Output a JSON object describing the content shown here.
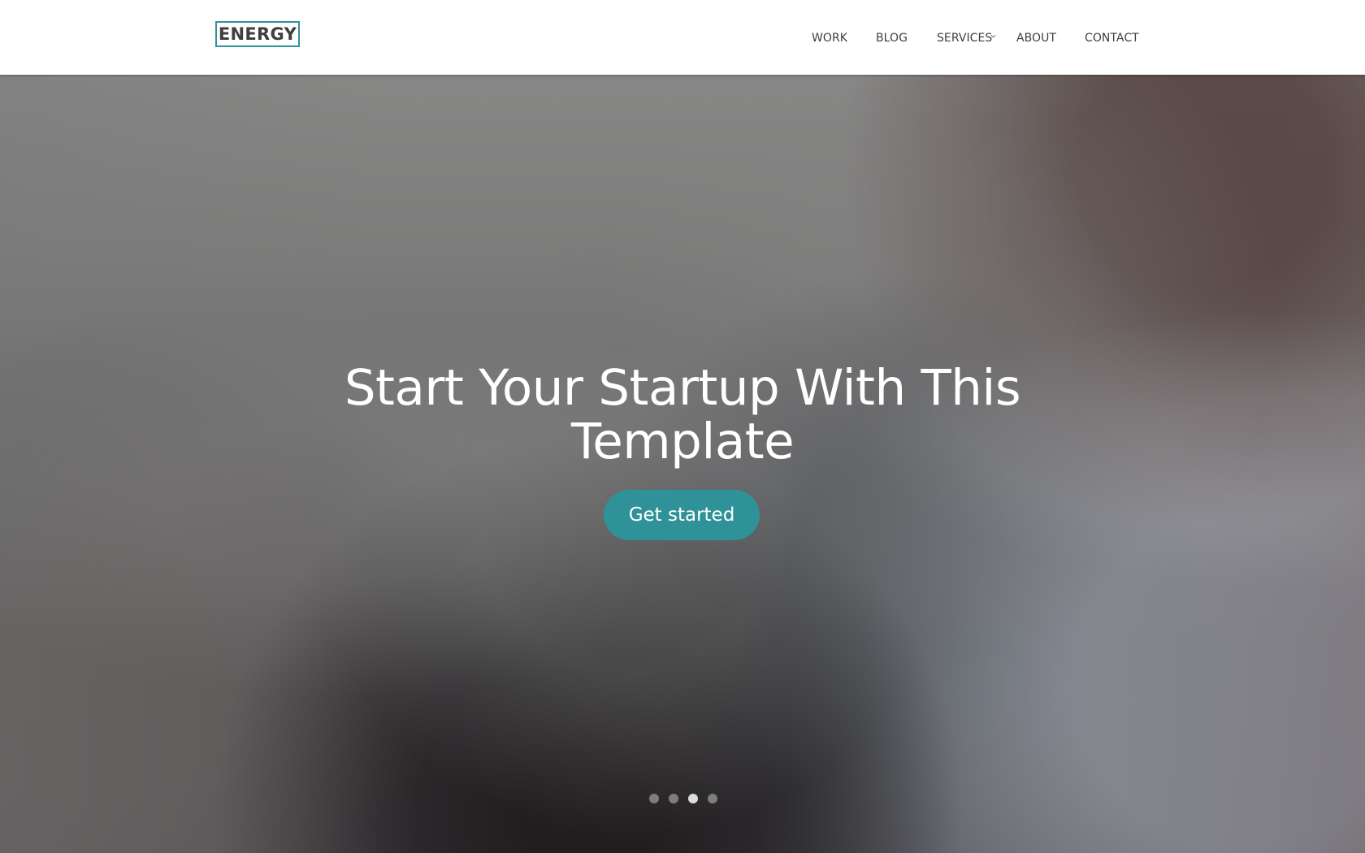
{
  "brand": {
    "name": "ENERGY",
    "accent_color": "#2f9298"
  },
  "nav": {
    "items": [
      {
        "label": "WORK"
      },
      {
        "label": "BLOG"
      },
      {
        "label": "SERVICES",
        "icon": "chevron-down-icon"
      },
      {
        "label": "ABOUT"
      },
      {
        "label": "CONTACT"
      }
    ]
  },
  "hero": {
    "title": "Start Your Startup With This Template",
    "cta_label": "Get started",
    "slider": {
      "total_slides": 4,
      "active_slide": 3
    }
  }
}
